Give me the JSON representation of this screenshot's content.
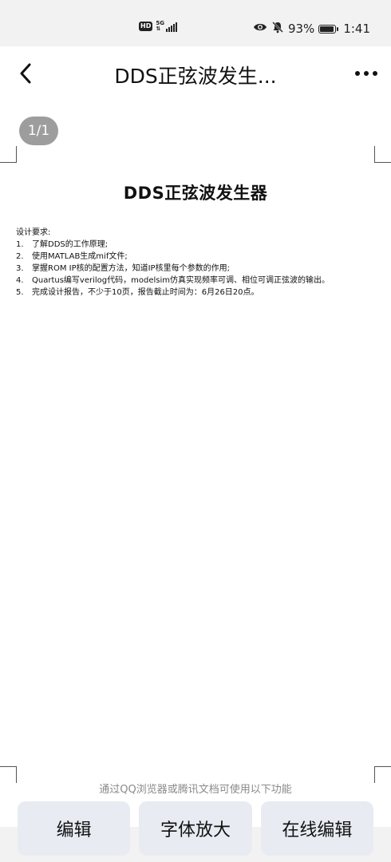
{
  "status_bar": {
    "hd": "HD",
    "network": "5G",
    "battery_percent": "93%",
    "time": "1:41",
    "battery_level": 0.93
  },
  "header": {
    "title": "DDS正弦波发生...",
    "back_icon": "chevron-left-icon",
    "more_icon": "more-horizontal-icon"
  },
  "page_indicator": "1/1",
  "document": {
    "title": "DDS正弦波发生器",
    "requirements_heading": "设计要求:",
    "requirements": [
      {
        "num": "1.",
        "text": "了解DDS的工作原理;"
      },
      {
        "num": "2.",
        "text": "使用MATLAB生成mif文件;"
      },
      {
        "num": "3.",
        "text": "掌握ROM IP核的配置方法，知道IP核里每个参数的作用;"
      },
      {
        "num": "4.",
        "text": "Quartus编写verilog代码，modelsim仿真实现频率可调、相位可调正弦波的输出。"
      },
      {
        "num": "5.",
        "text": "完成设计报告，不少于10页，报告截止时间为：6月26日20点。"
      }
    ]
  },
  "hint": "通过QQ浏览器或腾讯文档可使用以下功能",
  "actions": {
    "edit": "编辑",
    "enlarge_font": "字体放大",
    "online_edit": "在线编辑"
  }
}
